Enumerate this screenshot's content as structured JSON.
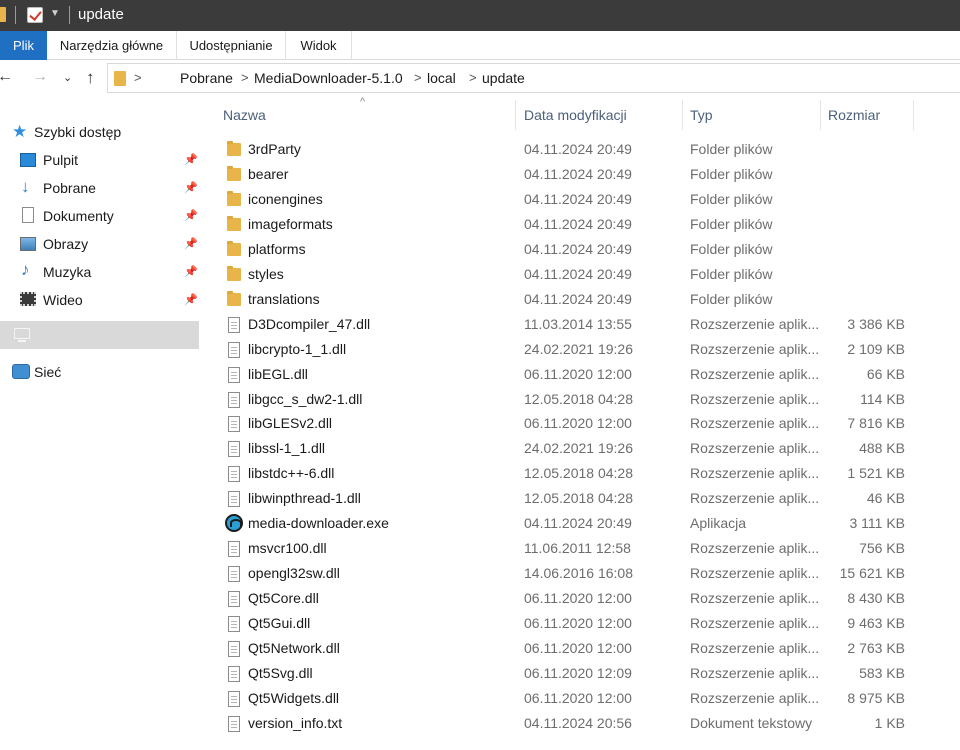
{
  "window": {
    "title": "update"
  },
  "ribbon": {
    "tabs": [
      "Plik",
      "Narzędzia główne",
      "Udostępnianie",
      "Widok"
    ]
  },
  "address": {
    "breadcrumbs": [
      "Pobrane",
      "MediaDownloader-5.1.0",
      "local",
      "update"
    ]
  },
  "sidebar": {
    "quick_access": "Szybki dostęp",
    "items": [
      {
        "label": "Pulpit",
        "icon": "desktop-icon"
      },
      {
        "label": "Pobrane",
        "icon": "download-arrow-icon"
      },
      {
        "label": "Dokumenty",
        "icon": "documents-icon"
      },
      {
        "label": "Obrazy",
        "icon": "pictures-icon"
      },
      {
        "label": "Muzyka",
        "icon": "music-note-icon"
      },
      {
        "label": "Wideo",
        "icon": "video-film-icon"
      }
    ],
    "network": "Sieć"
  },
  "columns": {
    "name": "Nazwa",
    "date": "Data modyfikacji",
    "type": "Typ",
    "size": "Rozmiar"
  },
  "files": [
    {
      "name": "3rdParty",
      "date": "04.11.2024 20:49",
      "type": "Folder plików",
      "size": "",
      "kind": "folder"
    },
    {
      "name": "bearer",
      "date": "04.11.2024 20:49",
      "type": "Folder plików",
      "size": "",
      "kind": "folder"
    },
    {
      "name": "iconengines",
      "date": "04.11.2024 20:49",
      "type": "Folder plików",
      "size": "",
      "kind": "folder"
    },
    {
      "name": "imageformats",
      "date": "04.11.2024 20:49",
      "type": "Folder plików",
      "size": "",
      "kind": "folder"
    },
    {
      "name": "platforms",
      "date": "04.11.2024 20:49",
      "type": "Folder plików",
      "size": "",
      "kind": "folder"
    },
    {
      "name": "styles",
      "date": "04.11.2024 20:49",
      "type": "Folder plików",
      "size": "",
      "kind": "folder"
    },
    {
      "name": "translations",
      "date": "04.11.2024 20:49",
      "type": "Folder plików",
      "size": "",
      "kind": "folder"
    },
    {
      "name": "D3Dcompiler_47.dll",
      "date": "11.03.2014 13:55",
      "type": "Rozszerzenie aplik...",
      "size": "3 386 KB",
      "kind": "doc"
    },
    {
      "name": "libcrypto-1_1.dll",
      "date": "24.02.2021 19:26",
      "type": "Rozszerzenie aplik...",
      "size": "2 109 KB",
      "kind": "doc"
    },
    {
      "name": "libEGL.dll",
      "date": "06.11.2020 12:00",
      "type": "Rozszerzenie aplik...",
      "size": "66 KB",
      "kind": "doc"
    },
    {
      "name": "libgcc_s_dw2-1.dll",
      "date": "12.05.2018 04:28",
      "type": "Rozszerzenie aplik...",
      "size": "114 KB",
      "kind": "doc"
    },
    {
      "name": "libGLESv2.dll",
      "date": "06.11.2020 12:00",
      "type": "Rozszerzenie aplik...",
      "size": "7 816 KB",
      "kind": "doc"
    },
    {
      "name": "libssl-1_1.dll",
      "date": "24.02.2021 19:26",
      "type": "Rozszerzenie aplik...",
      "size": "488 KB",
      "kind": "doc"
    },
    {
      "name": "libstdc++-6.dll",
      "date": "12.05.2018 04:28",
      "type": "Rozszerzenie aplik...",
      "size": "1 521 KB",
      "kind": "doc"
    },
    {
      "name": "libwinpthread-1.dll",
      "date": "12.05.2018 04:28",
      "type": "Rozszerzenie aplik...",
      "size": "46 KB",
      "kind": "doc"
    },
    {
      "name": "media-downloader.exe",
      "date": "04.11.2024 20:49",
      "type": "Aplikacja",
      "size": "3 111 KB",
      "kind": "app"
    },
    {
      "name": "msvcr100.dll",
      "date": "11.06.2011 12:58",
      "type": "Rozszerzenie aplik...",
      "size": "756 KB",
      "kind": "doc"
    },
    {
      "name": "opengl32sw.dll",
      "date": "14.06.2016 16:08",
      "type": "Rozszerzenie aplik...",
      "size": "15 621 KB",
      "kind": "doc"
    },
    {
      "name": "Qt5Core.dll",
      "date": "06.11.2020 12:00",
      "type": "Rozszerzenie aplik...",
      "size": "8 430 KB",
      "kind": "doc"
    },
    {
      "name": "Qt5Gui.dll",
      "date": "06.11.2020 12:00",
      "type": "Rozszerzenie aplik...",
      "size": "9 463 KB",
      "kind": "doc"
    },
    {
      "name": "Qt5Network.dll",
      "date": "06.11.2020 12:00",
      "type": "Rozszerzenie aplik...",
      "size": "2 763 KB",
      "kind": "doc"
    },
    {
      "name": "Qt5Svg.dll",
      "date": "06.11.2020 12:09",
      "type": "Rozszerzenie aplik...",
      "size": "583 KB",
      "kind": "doc"
    },
    {
      "name": "Qt5Widgets.dll",
      "date": "06.11.2020 12:00",
      "type": "Rozszerzenie aplik...",
      "size": "8 975 KB",
      "kind": "doc"
    },
    {
      "name": "version_info.txt",
      "date": "04.11.2024 20:56",
      "type": "Dokument tekstowy",
      "size": "1 KB",
      "kind": "doc"
    }
  ],
  "colors": {
    "accent": "#1f6fc2",
    "folder": "#e8b54a",
    "titlebar": "#3b3b3b",
    "header_text": "#4c607a",
    "selected_bg": "#d9d9d9"
  }
}
